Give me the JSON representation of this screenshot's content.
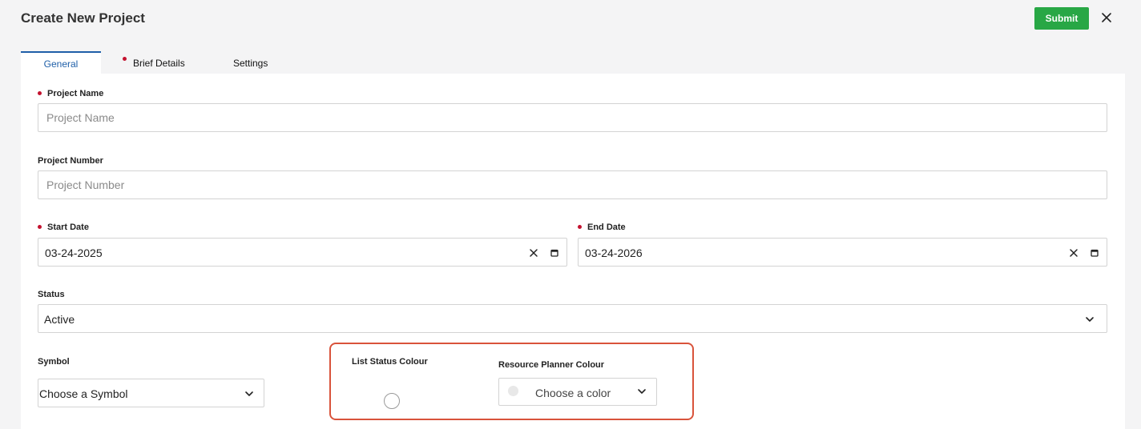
{
  "header": {
    "title": "Create New Project",
    "submit_label": "Submit"
  },
  "tabs": [
    {
      "label": "General",
      "active": true,
      "required": false
    },
    {
      "label": "Brief Details",
      "active": false,
      "required": true
    },
    {
      "label": "Settings",
      "active": false,
      "required": false
    }
  ],
  "form": {
    "project_name": {
      "label": "Project Name",
      "placeholder": "Project Name",
      "value": ""
    },
    "project_number": {
      "label": "Project Number",
      "placeholder": "Project Number",
      "value": ""
    },
    "start_date": {
      "label": "Start Date",
      "value": "03-24-2025"
    },
    "end_date": {
      "label": "End Date",
      "value": "03-24-2026"
    },
    "status": {
      "label": "Status",
      "value": "Active"
    },
    "symbol": {
      "label": "Symbol",
      "value": "Choose a Symbol"
    },
    "list_status_colour": {
      "label": "List Status Colour"
    },
    "resource_planner_colour": {
      "label": "Resource Planner Colour",
      "value": "Choose a color"
    }
  },
  "colors": {
    "accent_blue": "#1f5fa8",
    "submit_green": "#28a745",
    "required_red": "#c4122f",
    "highlight": "#d9533b"
  }
}
